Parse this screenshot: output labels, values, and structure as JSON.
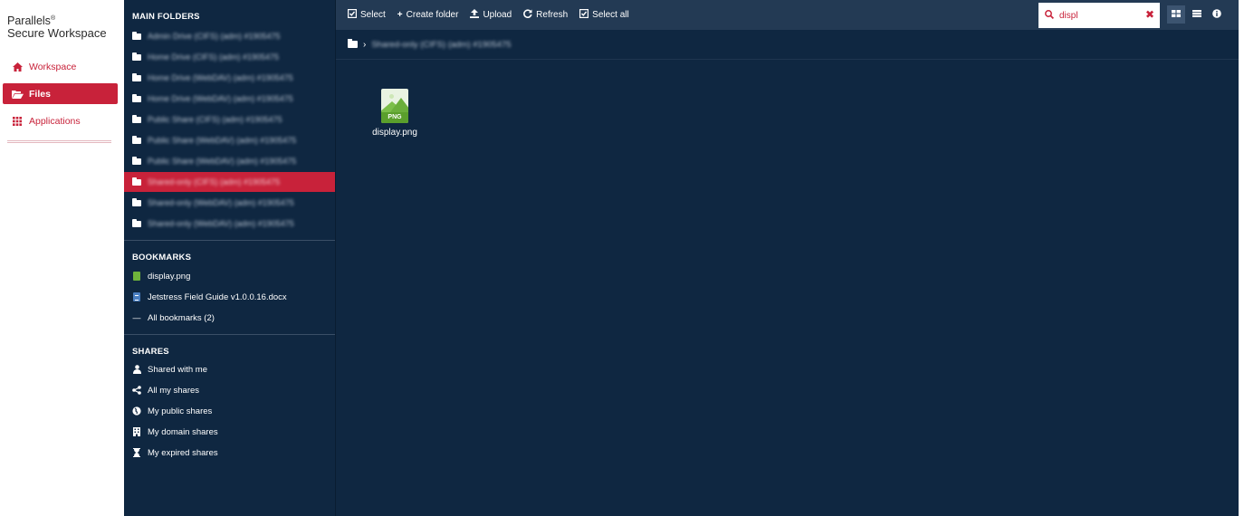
{
  "brand": {
    "line1": "Parallels",
    "reg": "®",
    "line2": "Secure Workspace"
  },
  "appnav": [
    {
      "label": "Workspace",
      "icon": "home-icon",
      "active": false
    },
    {
      "label": "Files",
      "icon": "folder-open-icon",
      "active": true
    },
    {
      "label": "Applications",
      "icon": "apps-grid-icon",
      "active": false
    }
  ],
  "sidebar": {
    "main_folders_title": "MAIN FOLDERS",
    "folders": [
      "Admin Drive (CIFS) (adm) #1905475",
      "Home Drive (CIFS) (adm) #1905475",
      "Home Drive (WebDAV) (adm) #1905475",
      "Home Drive (WebDAV) (adm) #1905475",
      "Public Share (CIFS) (adm) #1905475",
      "Public Share (WebDAV) (adm) #1905475",
      "Public Share (WebDAV) (adm) #1905475",
      "Shared-only (CIFS) (adm) #1905475",
      "Shared-only (WebDAV) (adm) #1905475",
      "Shared-only (WebDAV) (adm) #1905475"
    ],
    "active_folder_index": 7,
    "bookmarks_title": "BOOKMARKS",
    "bookmarks": [
      {
        "label": "display.png",
        "icon": "image-file-icon"
      },
      {
        "label": "Jetstress Field Guide v1.0.0.16.docx",
        "icon": "document-file-icon"
      },
      {
        "label": "All bookmarks (2)",
        "icon": "dash-icon"
      }
    ],
    "shares_title": "SHARES",
    "shares": [
      {
        "label": "Shared with me",
        "icon": "user-icon"
      },
      {
        "label": "All my shares",
        "icon": "share-icon"
      },
      {
        "label": "My public shares",
        "icon": "globe-icon"
      },
      {
        "label": "My domain shares",
        "icon": "building-icon"
      },
      {
        "label": "My expired shares",
        "icon": "hourglass-icon"
      }
    ]
  },
  "toolbar": {
    "select": "Select",
    "create_folder": "Create folder",
    "upload": "Upload",
    "refresh": "Refresh",
    "select_all": "Select all"
  },
  "search": {
    "value": "displ",
    "placeholder": "Search"
  },
  "view": {
    "active": "grid"
  },
  "path": {
    "current": "Shared-only (CIFS) (adm) #1905475"
  },
  "files": [
    {
      "name": "display.png",
      "type": "PNG"
    }
  ],
  "colors": {
    "accent": "#c8223a",
    "navy": "#0f2741",
    "toolbar": "#233a54"
  }
}
